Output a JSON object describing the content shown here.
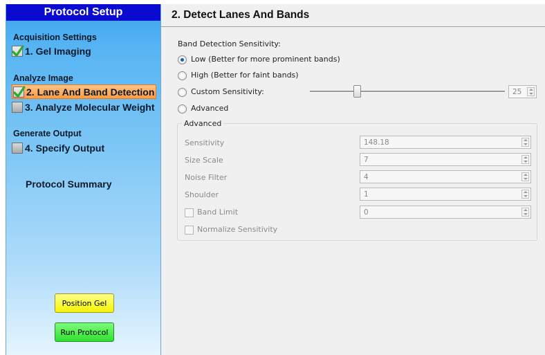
{
  "sidebar": {
    "title": "Protocol Setup",
    "sections": [
      {
        "label": "Acquisition Settings"
      },
      {
        "label": "Analyze Image"
      },
      {
        "label": "Generate Output"
      }
    ],
    "steps": [
      {
        "label": "1. Gel Imaging",
        "checked": true,
        "active": false
      },
      {
        "label": "2. Lane And Band Detection",
        "checked": true,
        "active": true
      },
      {
        "label": "3. Analyze Molecular Weight",
        "checked": false,
        "active": false
      },
      {
        "label": "4. Specify Output",
        "checked": false,
        "active": false
      }
    ],
    "summary_label": "Protocol Summary",
    "position_gel_label": "Position Gel",
    "run_protocol_label": "Run Protocol",
    "colors": {
      "title_bg": "#0a0ad0",
      "active_step": "#ff9b42",
      "position_gel": "#f5f500",
      "run_protocol": "#2fe02f",
      "check": "#2ea82e"
    }
  },
  "main": {
    "title": "2. Detect Lanes And Bands",
    "sensitivity_label": "Band Detection Sensitivity:",
    "options": [
      {
        "label": "Low (Better for more prominent bands)",
        "selected": true
      },
      {
        "label": "High (Better for faint bands)",
        "selected": false
      },
      {
        "label": "Custom Sensitivity:",
        "selected": false
      },
      {
        "label": "Advanced",
        "selected": false
      }
    ],
    "custom_value": "25",
    "advanced": {
      "group_title": "Advanced",
      "fields": [
        {
          "label": "Sensitivity",
          "value": "148.18"
        },
        {
          "label": "Size Scale",
          "value": "7"
        },
        {
          "label": "Noise Filter",
          "value": "4"
        },
        {
          "label": "Shoulder",
          "value": "1"
        },
        {
          "label": "Band Limit",
          "value": "0"
        }
      ],
      "normalize_label": "Normalize Sensitivity"
    }
  }
}
